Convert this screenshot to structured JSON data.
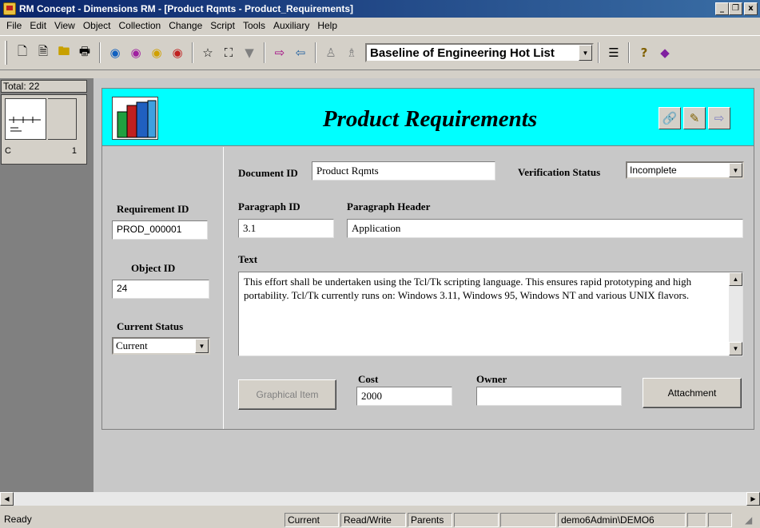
{
  "window": {
    "title": "RM Concept - Dimensions RM - [Product Rqmts - Product_Requirements]",
    "minimize": "_",
    "restore": "❐",
    "close": "x"
  },
  "menu": [
    {
      "label": "File",
      "name": "file"
    },
    {
      "label": "Edit",
      "name": "edit"
    },
    {
      "label": "View",
      "name": "view"
    },
    {
      "label": "Object",
      "name": "object"
    },
    {
      "label": "Collection",
      "name": "collection"
    },
    {
      "label": "Change",
      "name": "change"
    },
    {
      "label": "Script",
      "name": "script"
    },
    {
      "label": "Tools",
      "name": "tools"
    },
    {
      "label": "Auxiliary",
      "name": "auxiliary"
    },
    {
      "label": "Help",
      "name": "help"
    }
  ],
  "toolbar": {
    "baseline": "Baseline of Engineering Hot List"
  },
  "left_pane": {
    "total": "Total: 22",
    "thumb_class": "C",
    "thumb_count": "1"
  },
  "form": {
    "title": "Product Requirements",
    "document_id_label": "Document ID",
    "document_id": "Product Rqmts",
    "verification_label": "Verification Status",
    "verification_value": "Incomplete",
    "requirement_id_label": "Requirement ID",
    "requirement_id": "PROD_000001",
    "object_id_label": "Object ID",
    "object_id": "24",
    "current_status_label": "Current Status",
    "current_status": "Current",
    "paragraph_id_label": "Paragraph ID",
    "paragraph_id": "3.1",
    "paragraph_header_label": "Paragraph Header",
    "paragraph_header": "Application",
    "text_label": "Text",
    "text_value": "This effort shall be undertaken using the Tcl/Tk scripting language. This ensures rapid prototyping and high portability. Tcl/Tk currently runs on: Windows 3.11, Windows 95, Windows NT and various UNIX flavors.",
    "cost_label": "Cost",
    "cost": "2000",
    "owner_label": "Owner",
    "owner": "",
    "graphical_item_button": "Graphical Item",
    "attachment_button": "Attachment"
  },
  "statusbar": {
    "ready": "Ready",
    "status": "Current",
    "mode": "Read/Write",
    "parents": "Parents",
    "user": "demo6Admin\\DEMO6"
  },
  "colors": {
    "titlebar": "#0a246a",
    "banner": "#00ffff",
    "face": "#d4d0c8"
  }
}
